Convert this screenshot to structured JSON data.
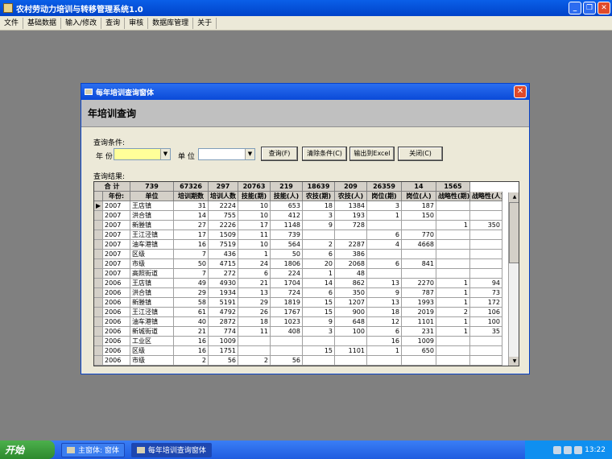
{
  "app": {
    "title": "农村劳动力培训与转移管理系统1.0"
  },
  "menu": [
    "文件",
    "基础数据",
    "输入/修改",
    "查询",
    "审核",
    "数据库管理",
    "关于"
  ],
  "dialog": {
    "title": "每年培训查询窗体",
    "heading": "年培训查询",
    "query_label": "查询条件:",
    "year_label": "年 份",
    "unit_label": "单 位",
    "year_value": "",
    "unit_value": "",
    "buttons": {
      "query": "查询(F)",
      "clear": "清除条件(C)",
      "export": "输出到Excel",
      "close": "关闭(C)"
    },
    "results_label": "查询结果:"
  },
  "table": {
    "total_label": "合  计",
    "totals": [
      "739",
      "67326",
      "297",
      "20763",
      "219",
      "18639",
      "209",
      "26359",
      "14",
      "1565"
    ],
    "columns": [
      "年份:",
      "单位",
      "培训期数",
      "培训人数",
      "技能(期)",
      "技能(人)",
      "农技(期)",
      "农技(人)",
      "岗位(期)",
      "岗位(人)",
      "战略性(期)",
      "战略性(人)"
    ],
    "rows": [
      [
        "2007",
        "王店镇",
        "31",
        "2224",
        "10",
        "653",
        "18",
        "1384",
        "3",
        "187",
        "",
        ""
      ],
      [
        "2007",
        "洪合镇",
        "14",
        "755",
        "10",
        "412",
        "3",
        "193",
        "1",
        "150",
        "",
        ""
      ],
      [
        "2007",
        "新塍镇",
        "27",
        "2226",
        "17",
        "1148",
        "9",
        "728",
        "",
        "",
        "1",
        "350"
      ],
      [
        "2007",
        "王江泾镇",
        "17",
        "1509",
        "11",
        "739",
        "",
        "",
        "6",
        "770",
        "",
        ""
      ],
      [
        "2007",
        "油车港镇",
        "16",
        "7519",
        "10",
        "564",
        "2",
        "2287",
        "4",
        "4668",
        "",
        ""
      ],
      [
        "2007",
        "区级",
        "7",
        "436",
        "1",
        "50",
        "6",
        "386",
        "",
        "",
        "",
        ""
      ],
      [
        "2007",
        "市级",
        "50",
        "4715",
        "24",
        "1806",
        "20",
        "2068",
        "6",
        "841",
        "",
        ""
      ],
      [
        "2007",
        "高照街道",
        "7",
        "272",
        "6",
        "224",
        "1",
        "48",
        "",
        "",
        "",
        ""
      ],
      [
        "2006",
        "王店镇",
        "49",
        "4930",
        "21",
        "1704",
        "14",
        "862",
        "13",
        "2270",
        "1",
        "94"
      ],
      [
        "2006",
        "洪合镇",
        "29",
        "1934",
        "13",
        "724",
        "6",
        "350",
        "9",
        "787",
        "1",
        "73"
      ],
      [
        "2006",
        "新塍镇",
        "58",
        "5191",
        "29",
        "1819",
        "15",
        "1207",
        "13",
        "1993",
        "1",
        "172"
      ],
      [
        "2006",
        "王江泾镇",
        "61",
        "4792",
        "26",
        "1767",
        "15",
        "900",
        "18",
        "2019",
        "2",
        "106"
      ],
      [
        "2006",
        "油车港镇",
        "40",
        "2872",
        "18",
        "1023",
        "9",
        "648",
        "12",
        "1101",
        "1",
        "100"
      ],
      [
        "2006",
        "新城街道",
        "21",
        "774",
        "11",
        "408",
        "3",
        "100",
        "6",
        "231",
        "1",
        "35"
      ],
      [
        "2006",
        "工业区",
        "16",
        "1009",
        "",
        "",
        "",
        "",
        "16",
        "1009",
        "",
        ""
      ],
      [
        "2006",
        "区级",
        "16",
        "1751",
        "",
        "",
        "15",
        "1101",
        "1",
        "650",
        "",
        ""
      ],
      [
        "2006",
        "市级",
        "2",
        "56",
        "2",
        "56",
        "",
        "",
        "",
        "",
        "",
        ""
      ]
    ]
  },
  "taskbar": {
    "start": "开始",
    "tasks": [
      "主窗体: 窗体",
      "每年培训查询窗体"
    ],
    "clock": "13:22"
  },
  "colors": {
    "year_combo_bg": "#ffff99",
    "titlebar": "#0a5fe8",
    "desktop": "#808080"
  }
}
